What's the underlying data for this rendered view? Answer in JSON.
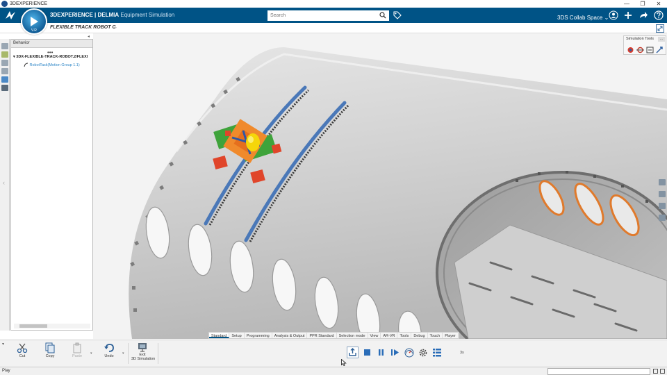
{
  "window": {
    "title": "3DEXPERIENCE",
    "controls": [
      "—",
      "❐",
      "✕"
    ]
  },
  "brand": {
    "app": "3DEXPERIENCE | DELMIA",
    "module": "Equipment Simulation"
  },
  "compass": {
    "label": "V.R"
  },
  "search": {
    "placeholder": "Search"
  },
  "collab_space": "3DS Collab Space",
  "document_tab": "FLEXIBLE TRACK ROBOT C",
  "tab_add": "+",
  "tree": {
    "header": "Behavior",
    "more": "•••",
    "root": "3DX-FLEXIBLE-TRACK-ROBOT.2/FLEXI",
    "child": "RobotTask(Motion Group 1.1)"
  },
  "simulation_tools": {
    "title": "Simulation Tools",
    "more": "..."
  },
  "workbench_tabs": [
    {
      "label": "Standard",
      "active": true
    },
    {
      "label": "Setup",
      "active": false
    },
    {
      "label": "Programming",
      "active": false
    },
    {
      "label": "Analysis & Output",
      "active": false
    },
    {
      "label": "PPR Standard",
      "active": false
    },
    {
      "label": "Selection mode",
      "active": false
    },
    {
      "label": "View",
      "active": false
    },
    {
      "label": "AR-VR",
      "active": false
    },
    {
      "label": "Tools",
      "active": false
    },
    {
      "label": "Debug",
      "active": false
    },
    {
      "label": "Touch",
      "active": false
    },
    {
      "label": "Player",
      "active": false
    }
  ],
  "actions": {
    "cut": "Cut",
    "copy": "Copy",
    "paste": "Paste",
    "undo": "Undo",
    "exit_line1": "Exit",
    "exit_line2": "3D Simulation"
  },
  "player": {
    "speed": "3s"
  },
  "status": {
    "text": "Play"
  },
  "colors": {
    "top_bar": "#005386",
    "accent": "#2d86c7",
    "track_blue": "#4a78b8",
    "robot_green": "#3fa33b",
    "robot_orange": "#f08a2c",
    "robot_yellow": "#f5d60a",
    "robot_red": "#e0452a"
  }
}
